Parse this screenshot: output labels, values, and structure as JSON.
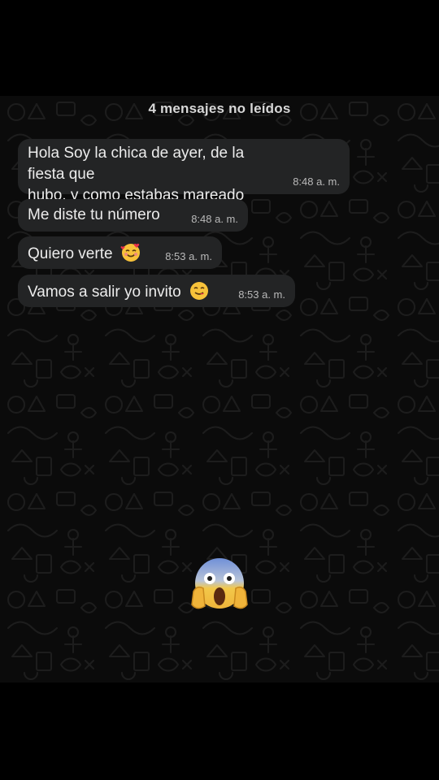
{
  "chat": {
    "unread_banner": "4 mensajes no leídos",
    "messages": [
      {
        "text": "Hola Soy la chica de ayer, de la fiesta que\nhubo, y como estabas mareado",
        "time": "8:48 a. m."
      },
      {
        "text": "Me diste tu número",
        "time": "8:48 a. m."
      },
      {
        "text": "Quiero verte",
        "emoji": "smiling-face-with-hearts",
        "time": "8:53 a. m."
      },
      {
        "text": "Vamos a salir yo invito",
        "emoji": "face-savoring-food",
        "time": "8:53 a. m."
      }
    ],
    "overlay_emoji": "face-screaming-in-fear"
  },
  "colors": {
    "background": "#000000",
    "chat_background": "#0b0b0b",
    "bubble": "#232425",
    "text": "#ececec",
    "time": "#b9b9b9"
  }
}
